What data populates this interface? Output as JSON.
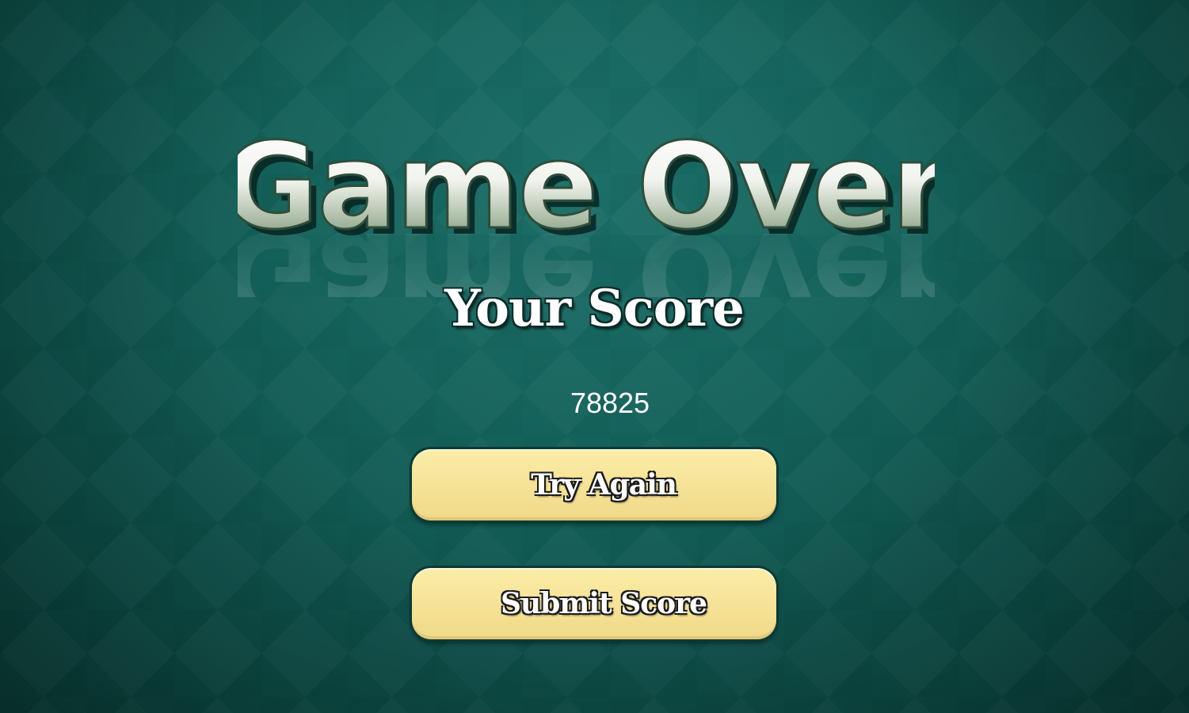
{
  "screen": {
    "title": "Game Over",
    "score_label": "Your Score",
    "score_value": "78825"
  },
  "buttons": {
    "try_again": "Try Again",
    "submit_score": "Submit Score"
  },
  "colors": {
    "background": "#14625b",
    "background_dark": "#0a3e39",
    "button_fill": "#f6e397",
    "title_top": "#ffffff",
    "title_bottom": "#5b7a5b",
    "text": "#ffffff"
  }
}
